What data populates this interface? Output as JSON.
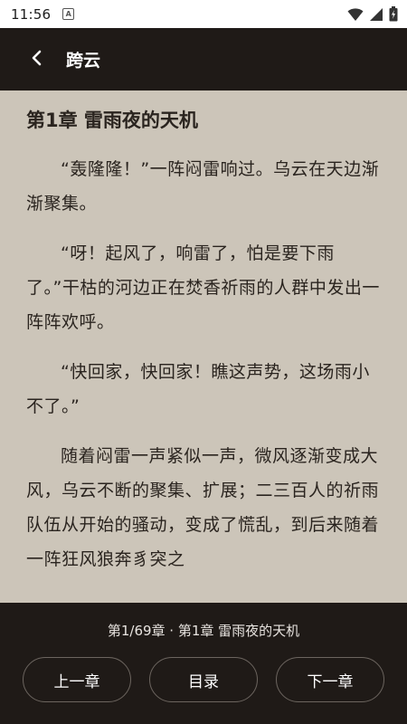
{
  "status_bar": {
    "time": "11:56",
    "notification_icon": "font-a-icon",
    "icons": [
      "wifi-icon",
      "signal-icon",
      "battery-icon"
    ]
  },
  "app_bar": {
    "back_icon": "chevron-left-icon",
    "title": "跨云"
  },
  "chapter": {
    "heading": "第1章 雷雨夜的天机",
    "paragraphs": [
      "“轰隆隆！”一阵闷雷响过。乌云在天边渐渐聚集。",
      "“呀！起风了，响雷了，怕是要下雨了。”干枯的河边正在焚香祈雨的人群中发出一阵阵欢呼。",
      "“快回家，快回家！瞧这声势，这场雨小不了。”",
      "随着闷雷一声紧似一声，微风逐渐变成大风，乌云不断的聚集、扩展；二三百人的祈雨队伍从开始的骚动，变成了慌乱，到后来随着一阵狂风狼奔豸突之"
    ]
  },
  "bottom_panel": {
    "progress": "第1/69章 · 第1章 雷雨夜的天机",
    "prev_label": "上一章",
    "toc_label": "目录",
    "next_label": "下一章"
  },
  "colors": {
    "background": "#ccc5b9",
    "bar": "#1f1a17",
    "text": "#2a241f"
  }
}
